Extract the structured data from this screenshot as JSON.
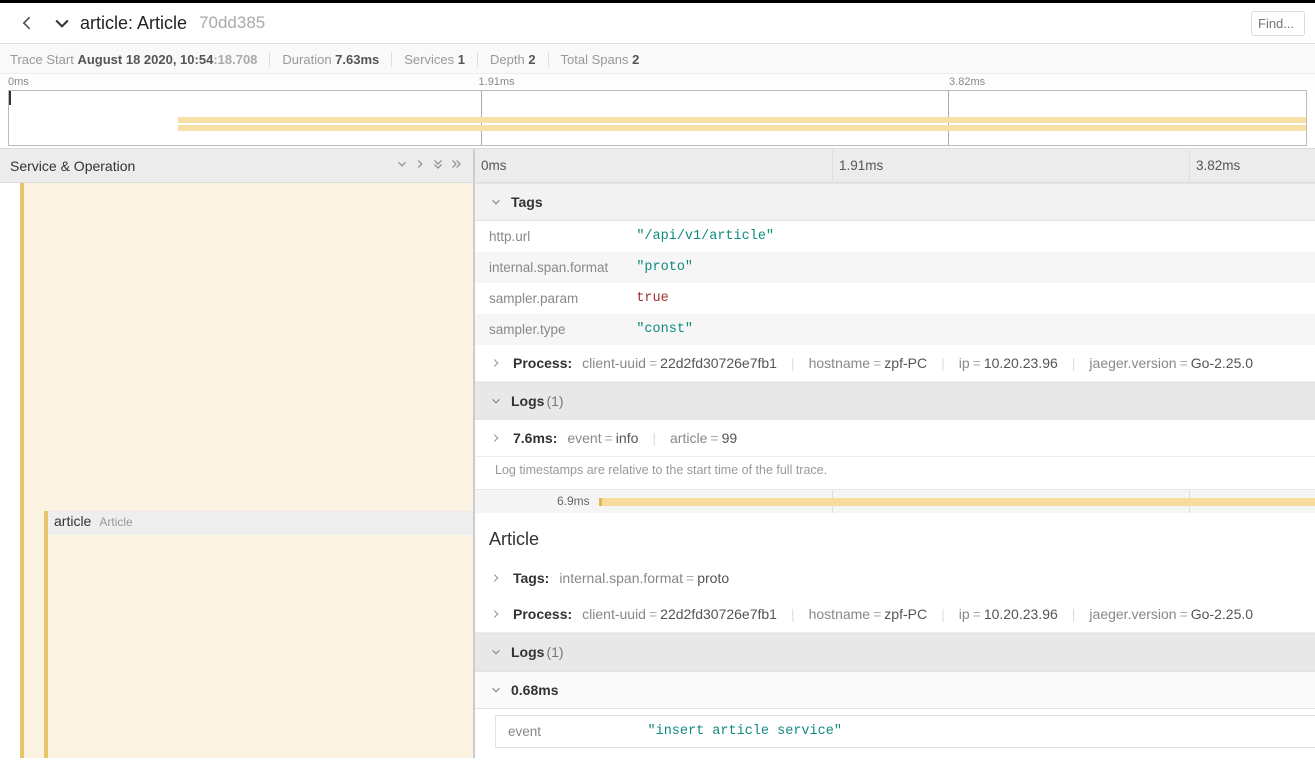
{
  "header": {
    "service": "article",
    "operation": "Article",
    "trace_id": "70dd385",
    "find_placeholder": "Find..."
  },
  "summary": {
    "trace_start_label": "Trace Start",
    "trace_start_value": "August 18 2020, 10:54",
    "trace_start_ms": ":18.708",
    "duration_label": "Duration",
    "duration_value": "7.63ms",
    "services_label": "Services",
    "services_value": "1",
    "depth_label": "Depth",
    "depth_value": "2",
    "spans_label": "Total Spans",
    "spans_value": "2"
  },
  "ruler": {
    "t0": "0ms",
    "t1": "1.91ms",
    "t2": "3.82ms"
  },
  "cols": {
    "title": "Service & Operation",
    "t0": "0ms",
    "t1": "1.91ms",
    "t2": "3.82ms"
  },
  "span1": {
    "tags_label": "Tags",
    "tags": {
      "http_url_k": "http.url",
      "http_url_v": "\"/api/v1/article\"",
      "fmt_k": "internal.span.format",
      "fmt_v": "\"proto\"",
      "sampler_param_k": "sampler.param",
      "sampler_param_v": "true",
      "sampler_type_k": "sampler.type",
      "sampler_type_v": "\"const\""
    },
    "process_label": "Process:",
    "process": {
      "uuid_k": "client-uuid",
      "uuid_v": "22d2fd30726e7fb1",
      "host_k": "hostname",
      "host_v": "zpf-PC",
      "ip_k": "ip",
      "ip_v": "10.20.23.96",
      "ver_k": "jaeger.version",
      "ver_v": "Go-2.25.0"
    },
    "logs_label": "Logs",
    "logs_count": "(1)",
    "log_time": "7.6ms:",
    "log_kv": {
      "event_k": "event",
      "event_v": "info",
      "article_k": "article",
      "article_v": "99"
    },
    "log_note": "Log timestamps are relative to the start time of the full trace."
  },
  "span2": {
    "row_service": "article",
    "row_op": "Article",
    "duration": "6.9ms",
    "title": "Article",
    "tags_label": "Tags:",
    "tags": {
      "fmt_k": "internal.span.format",
      "fmt_v": "proto"
    },
    "process_label": "Process:",
    "process": {
      "uuid_k": "client-uuid",
      "uuid_v": "22d2fd30726e7fb1",
      "host_k": "hostname",
      "host_v": "zpf-PC",
      "ip_k": "ip",
      "ip_v": "10.20.23.96",
      "ver_k": "jaeger.version",
      "ver_v": "Go-2.25.0"
    },
    "logs_label": "Logs",
    "logs_count": "(1)",
    "log_time": "0.68ms",
    "log_event_k": "event",
    "log_event_v": "\"insert article service\""
  }
}
